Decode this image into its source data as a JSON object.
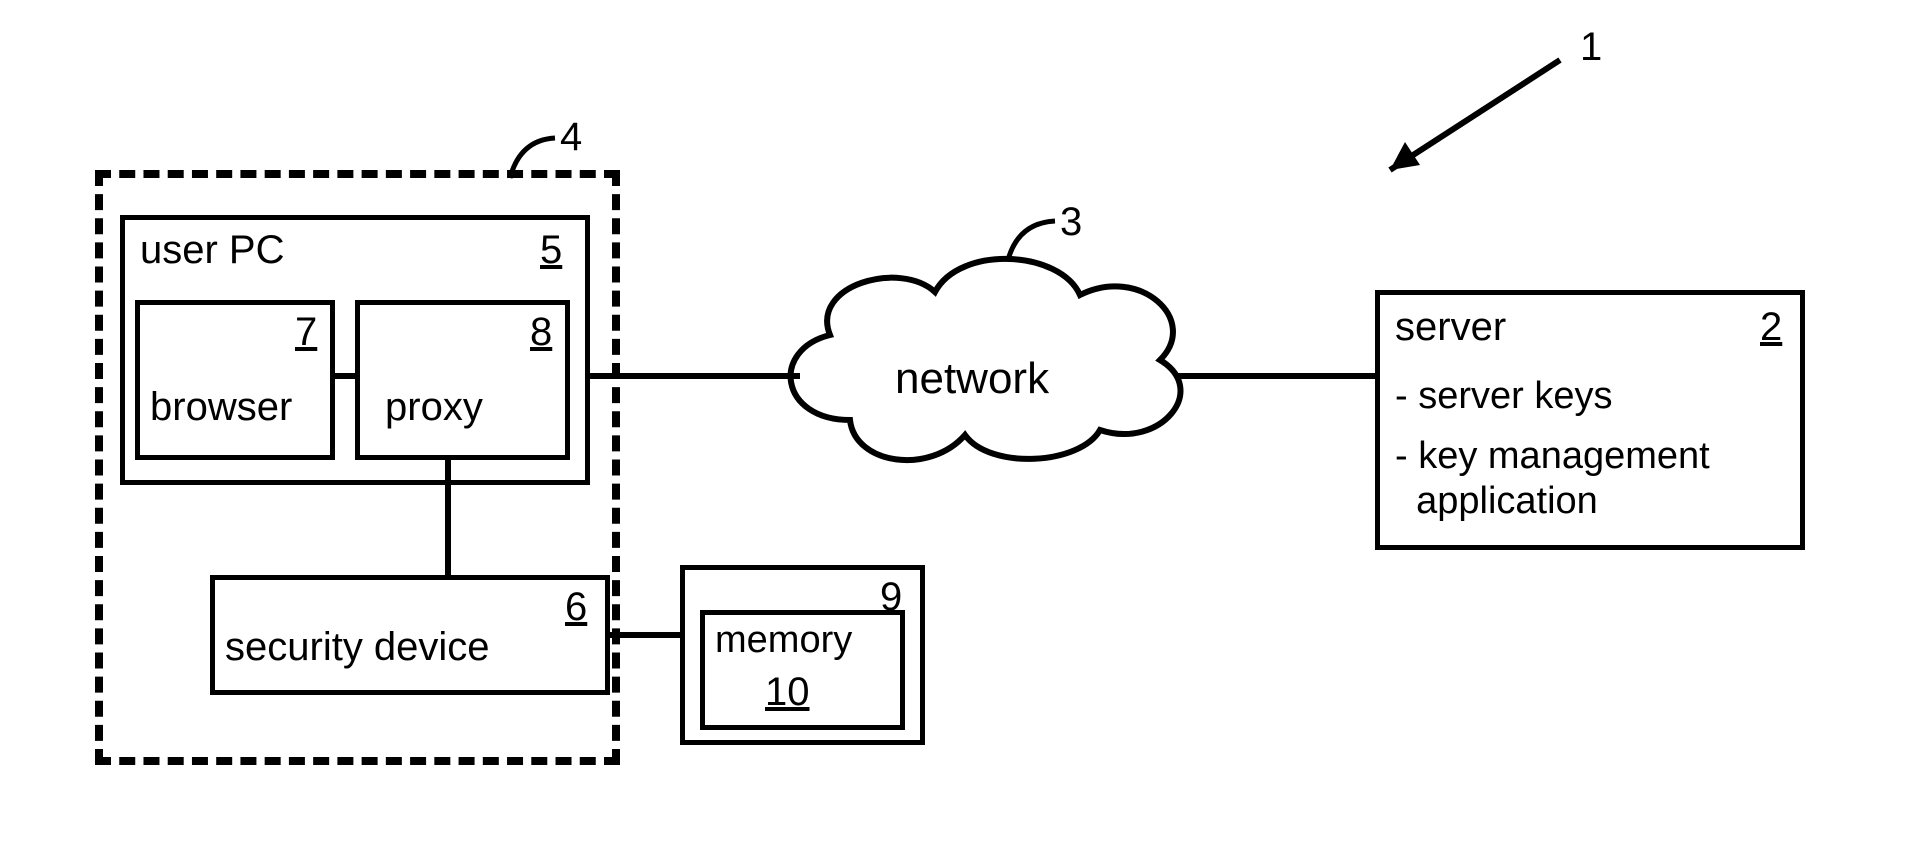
{
  "refs": {
    "system": "1",
    "server": "2",
    "network": "3",
    "client_group": "4",
    "user_pc": "5",
    "security_device": "6",
    "browser": "7",
    "proxy": "8",
    "mem_outer": "9",
    "mem_inner": "10"
  },
  "labels": {
    "user_pc": "user PC",
    "browser": "browser",
    "proxy": "proxy",
    "security_device": "security device",
    "memory": "memory",
    "network": "network",
    "server_title": "server",
    "server_line1": "- server keys",
    "server_line2": "- key management",
    "server_line3": "  application"
  }
}
